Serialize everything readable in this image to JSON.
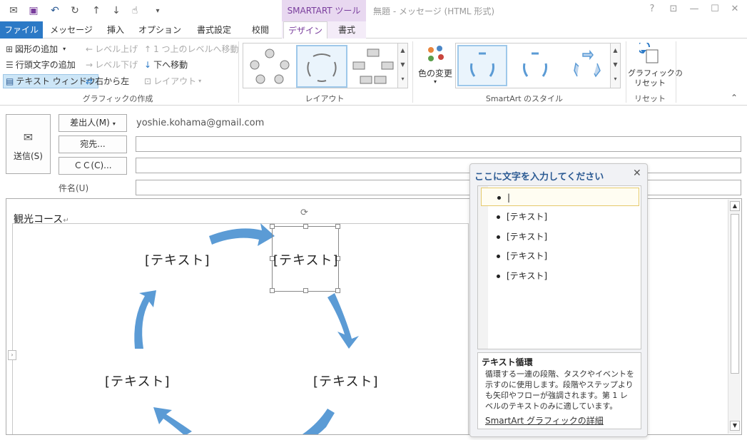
{
  "title_bar": {
    "context_label": "SMARTART ツール",
    "window_title": "無題 - メッセージ (HTML 形式)",
    "help": "?",
    "restore_ribbon": "⊡",
    "minimize": "—",
    "maximize": "☐",
    "close": "✕"
  },
  "tabs": [
    "ファイル",
    "メッセージ",
    "挿入",
    "オプション",
    "書式設定",
    "校閲",
    "デザイン",
    "書式"
  ],
  "ribbon": {
    "create": {
      "add_shape": "図形の追加",
      "add_bullet": "行頭文字の追加",
      "text_pane": "テキスト ウィンドウ",
      "promote": "レベル上げ",
      "demote": "レベル下げ",
      "move_up": "1 つ上のレベルへ移動",
      "move_down": "下へ移動",
      "rtl": "右から左",
      "layout": "レイアウト",
      "group": "グラフィックの作成"
    },
    "layout_group": "レイアウト",
    "color_change": "色の変更",
    "styles_group": "SmartArt のスタイル",
    "reset_label": "グラフィックの\nリセット",
    "reset_group": "リセット"
  },
  "form": {
    "send": "送信(S)",
    "from_button": "差出人(M)",
    "from_value": "yoshie.kohama@gmail.com",
    "to_button": "宛先...",
    "cc_button": "ＣＣ(C)...",
    "subject_label": "件名(U)"
  },
  "body": {
    "heading": "観光コース",
    "nodes": [
      "[テキスト]",
      "[テキスト]",
      "[テキスト]",
      "[テキスト]"
    ]
  },
  "text_pane": {
    "title": "ここに文字を入力してください",
    "items": [
      "",
      "[テキスト]",
      "[テキスト]",
      "[テキスト]",
      "[テキスト]"
    ],
    "desc_title": "テキスト循環",
    "desc_body": "循環する一連の段階、タスクやイベントを示すのに使用します。段階やステップよりも矢印やフローが強調されます。第 1 レベルのテキストのみに適しています。",
    "link": "SmartArt グラフィックの詳細"
  },
  "colors": {
    "accent": "#2b79c6",
    "context": "#7a3e9d",
    "arrow": "#5b9bd5"
  }
}
